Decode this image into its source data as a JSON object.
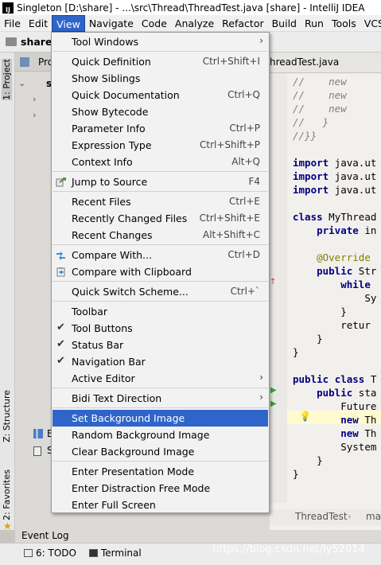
{
  "window": {
    "title": "Singleton [D:\\share] - ...\\src\\Thread\\ThreadTest.java [share] - IntelliJ IDEA",
    "app_icon_text": "IJ"
  },
  "menubar": {
    "items": [
      "File",
      "Edit",
      "View",
      "Navigate",
      "Code",
      "Analyze",
      "Refactor",
      "Build",
      "Run",
      "Tools",
      "VCS"
    ],
    "active": "View"
  },
  "navbar": {
    "crumb": "share"
  },
  "stripe": {
    "project": "1: Project",
    "structure": "Z: Structure",
    "favorites": "2: Favorites"
  },
  "project_panel": {
    "header": "Pro",
    "item_s": "s",
    "item_b": "B",
    "item_s2": "S"
  },
  "editor": {
    "tab": "hreadTest.java",
    "code_lines": [
      "//    new",
      "//    new",
      "//    new",
      "//   }",
      "//}}",
      "",
      "import java.ut",
      "import java.ut",
      "import java.ut",
      "",
      "class MyThread",
      "    private in",
      "",
      "    @Override",
      "    public Str",
      "        while",
      "            Sy",
      "        }",
      "        retur",
      "    }",
      "}",
      "",
      "public class T",
      "    public sta",
      "        Future",
      "        new Th",
      "        new Th",
      "        System",
      "    }",
      "}"
    ],
    "breadcrumb_1": "ThreadTest",
    "breadcrumb_2": "ma"
  },
  "bottom": {
    "event_log": "Event Log",
    "todo": "6: TODO",
    "terminal": "Terminal",
    "watermark": "https://blog.csdn.net/ly52014"
  },
  "view_menu": {
    "tool_windows": "Tool Windows",
    "quick_definition": "Quick Definition",
    "quick_definition_sc": "Ctrl+Shift+I",
    "show_siblings": "Show Siblings",
    "quick_documentation": "Quick Documentation",
    "quick_documentation_sc": "Ctrl+Q",
    "show_bytecode": "Show Bytecode",
    "parameter_info": "Parameter Info",
    "parameter_info_sc": "Ctrl+P",
    "expression_type": "Expression Type",
    "expression_type_sc": "Ctrl+Shift+P",
    "context_info": "Context Info",
    "context_info_sc": "Alt+Q",
    "jump_to_source": "Jump to Source",
    "jump_to_source_sc": "F4",
    "recent_files": "Recent Files",
    "recent_files_sc": "Ctrl+E",
    "recently_changed_files": "Recently Changed Files",
    "recently_changed_files_sc": "Ctrl+Shift+E",
    "recent_changes": "Recent Changes",
    "recent_changes_sc": "Alt+Shift+C",
    "compare_with": "Compare With...",
    "compare_with_sc": "Ctrl+D",
    "compare_with_clipboard": "Compare with Clipboard",
    "quick_switch_scheme": "Quick Switch Scheme...",
    "quick_switch_scheme_sc": "Ctrl+`",
    "toolbar": "Toolbar",
    "tool_buttons": "Tool Buttons",
    "tool_buttons_checked": true,
    "status_bar": "Status Bar",
    "status_bar_checked": true,
    "navigation_bar": "Navigation Bar",
    "navigation_bar_checked": true,
    "active_editor": "Active Editor",
    "bidi_text_direction": "Bidi Text Direction",
    "set_background_image": "Set Background Image",
    "random_background_image": "Random Background Image",
    "clear_background_image": "Clear Background Image",
    "enter_presentation_mode": "Enter Presentation Mode",
    "enter_distraction_free_mode": "Enter Distraction Free Mode",
    "enter_full_screen": "Enter Full Screen",
    "highlighted": "Set Background Image",
    "submenu_arrow": "›",
    "check_mark": "✔"
  },
  "colors": {
    "highlight": "#2f65ca",
    "menu_bg": "#f2f2f2"
  }
}
